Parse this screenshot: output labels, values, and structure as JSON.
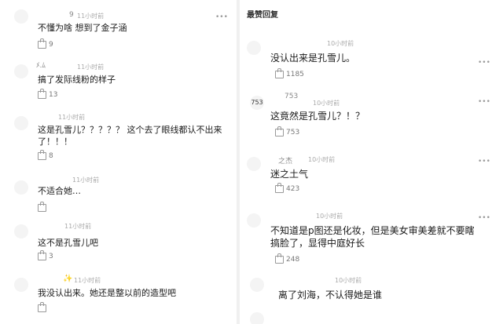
{
  "left": {
    "comments": [
      {
        "avatar": "",
        "user": "9",
        "time": "11小时前",
        "text": "不懂为啥 想到了金子涵",
        "likes": "9"
      },
      {
        "avatar": "",
        "user": "ﾒ.ﾑ",
        "time": "11小时前",
        "text": "搞了发际线粉的样子",
        "likes": "13"
      },
      {
        "avatar": "",
        "user": "",
        "time": "11小时前",
        "text": "这是孔雪儿？？？？？ 这个去了眼线都认不出来了！！！",
        "likes": "8"
      },
      {
        "avatar": "",
        "user": "",
        "time": "11小时前",
        "text": "不适合她…",
        "likes": ""
      },
      {
        "avatar": "",
        "user": "",
        "time": "11小时前",
        "text": "这不是孔雪儿吧",
        "likes": "3"
      },
      {
        "avatar": "",
        "user": "✨",
        "time": "11小时前",
        "text": "我没认出来。她还是整以前的造型吧",
        "likes": ""
      }
    ]
  },
  "right": {
    "section_title": "最赞回复",
    "comments": [
      {
        "avatar": "",
        "user": "",
        "time": "10小时前",
        "text": "没认出来是孔雪儿。",
        "likes": "1185"
      },
      {
        "avatar": "753",
        "user": "753",
        "time": "10小时前",
        "text": "这竟然是孔雪儿？！？",
        "likes": "753"
      },
      {
        "avatar": "",
        "user": "之杰",
        "time": "10小时前",
        "text": "迷之土气",
        "likes": "423"
      },
      {
        "avatar": "",
        "user": "",
        "time": "10小时前",
        "text": "不知道是p图还是化妆，但是美女审美差就不要瞎搞脸了，显得中庭好长",
        "likes": "248"
      },
      {
        "avatar": "",
        "user": "",
        "time": "10小时前",
        "text": "离了刘海，不认得她是谁",
        "likes": ""
      },
      {
        "avatar": "",
        "user": "",
        "time": "",
        "text": "",
        "likes": ""
      }
    ]
  }
}
